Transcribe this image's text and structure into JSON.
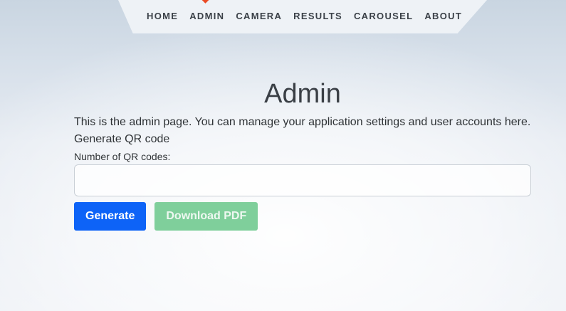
{
  "nav": {
    "items": [
      {
        "label": "HOME"
      },
      {
        "label": "ADMIN"
      },
      {
        "label": "CAMERA"
      },
      {
        "label": "RESULTS"
      },
      {
        "label": "CAROUSEL"
      },
      {
        "label": "ABOUT"
      }
    ],
    "active_item": "ADMIN"
  },
  "page": {
    "title": "Admin",
    "intro": "This is the admin page. You can manage your application settings and user accounts here."
  },
  "qr": {
    "section_title": "Generate QR code",
    "label": "Number of QR codes:",
    "value": "",
    "generate_label": "Generate",
    "download_label": "Download PDF",
    "download_disabled": true
  },
  "colors": {
    "primary": "#0d63f7",
    "success_disabled": "#7fcf9b",
    "nav_marker": "#ea4a24"
  }
}
